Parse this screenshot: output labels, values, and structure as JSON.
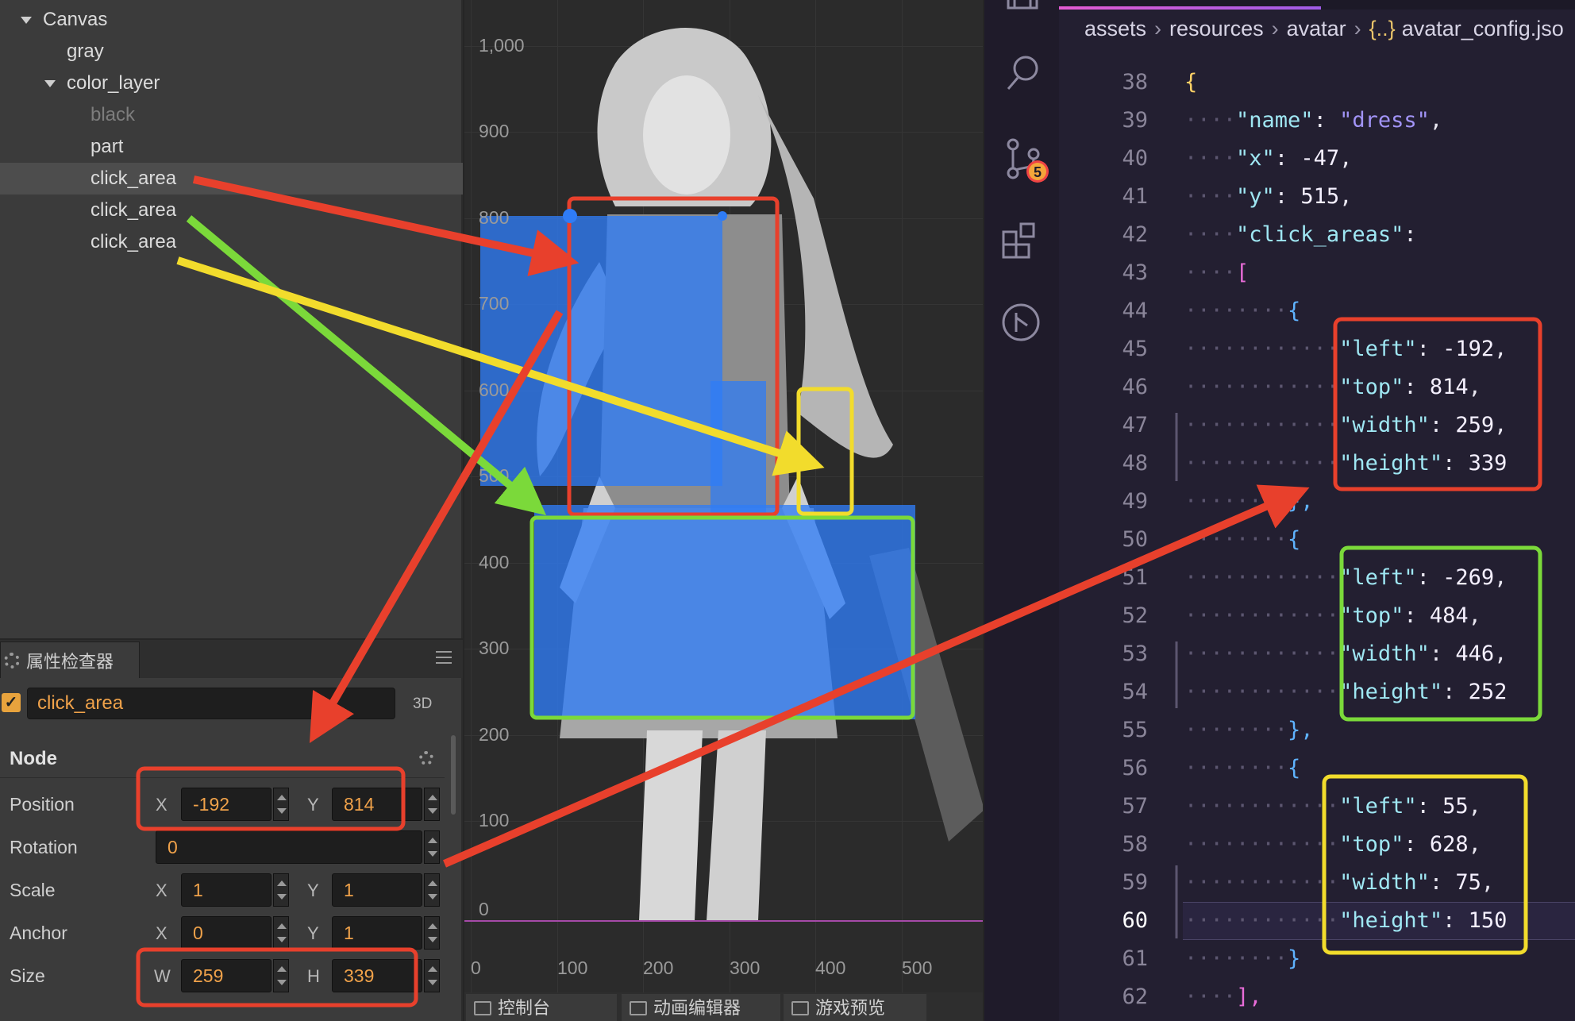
{
  "hierarchy": {
    "items": [
      {
        "label": "Canvas",
        "expanded": true,
        "depth": 0
      },
      {
        "label": "gray",
        "depth": 1
      },
      {
        "label": "color_layer",
        "expanded": true,
        "depth": 1
      },
      {
        "label": "black",
        "depth": 2,
        "dim": true
      },
      {
        "label": "part",
        "depth": 2
      },
      {
        "label": "click_area",
        "depth": 2,
        "selected": true
      },
      {
        "label": "click_area",
        "depth": 2
      },
      {
        "label": "click_area",
        "depth": 2
      }
    ]
  },
  "inspector": {
    "tab_label": "属性检查器",
    "node_name": "click_area",
    "mode_3d": "3D",
    "section_title": "Node",
    "position": {
      "label": "Position",
      "x_axis": "X",
      "y_axis": "Y",
      "x": "-192",
      "y": "814"
    },
    "rotation": {
      "label": "Rotation",
      "value": "0"
    },
    "scale": {
      "label": "Scale",
      "x_axis": "X",
      "y_axis": "Y",
      "x": "1",
      "y": "1"
    },
    "anchor": {
      "label": "Anchor",
      "x_axis": "X",
      "y_axis": "Y",
      "x": "0",
      "y": "1"
    },
    "size": {
      "label": "Size",
      "w_axis": "W",
      "h_axis": "H",
      "w": "259",
      "h": "339"
    }
  },
  "scene": {
    "y_ticks": [
      "1,000",
      "900",
      "800",
      "700",
      "600",
      "500",
      "400",
      "300",
      "200",
      "100",
      "0"
    ],
    "x_ticks": [
      "0",
      "100",
      "200",
      "300",
      "400",
      "500"
    ],
    "click_areas_colors": {
      "dress_top": "#e8402c",
      "skirt": "#7bd93a",
      "sleeve": "#f2dc2c"
    },
    "fill_color": "#2f7cf6"
  },
  "bottom_tabs": [
    "控制台",
    "动画编辑器",
    "游戏预览"
  ],
  "activity_bar": {
    "badge": "5",
    "icons": [
      "explorer-icon",
      "search-icon",
      "source-control-icon",
      "extensions-icon",
      "git-graph-icon"
    ]
  },
  "editor": {
    "breadcrumb": [
      "assets",
      "resources",
      "avatar",
      "avatar_config.jso"
    ],
    "active_line": "60",
    "lines": [
      {
        "n": "38",
        "text": "{",
        "cls": "b1",
        "indent": 0
      },
      {
        "n": "39",
        "key": "\"name\"",
        "val": "\"dress\"",
        "vcls": "s",
        "tail": ",",
        "indent": 1
      },
      {
        "n": "40",
        "key": "\"x\"",
        "val": "-47",
        "vcls": "n",
        "tail": ",",
        "indent": 1
      },
      {
        "n": "41",
        "key": "\"y\"",
        "val": "515",
        "vcls": "n",
        "tail": ",",
        "indent": 1
      },
      {
        "n": "42",
        "key": "\"click_areas\"",
        "val": "",
        "vcls": "n",
        "tail": "",
        "indent": 1
      },
      {
        "n": "43",
        "text": "[",
        "cls": "b2",
        "indent": 1
      },
      {
        "n": "44",
        "text": "{",
        "cls": "b3",
        "indent": 2
      },
      {
        "n": "45",
        "key": "\"left\"",
        "val": "-192",
        "vcls": "n",
        "tail": ",",
        "indent": 3
      },
      {
        "n": "46",
        "key": "\"top\"",
        "val": "814",
        "vcls": "n",
        "tail": ",",
        "indent": 3
      },
      {
        "n": "47",
        "key": "\"width\"",
        "val": "259",
        "vcls": "n",
        "tail": ",",
        "indent": 3
      },
      {
        "n": "48",
        "key": "\"height\"",
        "val": "339",
        "vcls": "n",
        "tail": "",
        "indent": 3
      },
      {
        "n": "49",
        "text": "},",
        "cls": "b3",
        "indent": 2
      },
      {
        "n": "50",
        "text": "{",
        "cls": "b3",
        "indent": 2
      },
      {
        "n": "51",
        "key": "\"left\"",
        "val": "-269",
        "vcls": "n",
        "tail": ",",
        "indent": 3
      },
      {
        "n": "52",
        "key": "\"top\"",
        "val": "484",
        "vcls": "n",
        "tail": ",",
        "indent": 3
      },
      {
        "n": "53",
        "key": "\"width\"",
        "val": "446",
        "vcls": "n",
        "tail": ",",
        "indent": 3
      },
      {
        "n": "54",
        "key": "\"height\"",
        "val": "252",
        "vcls": "n",
        "tail": "",
        "indent": 3
      },
      {
        "n": "55",
        "text": "},",
        "cls": "b3",
        "indent": 2
      },
      {
        "n": "56",
        "text": "{",
        "cls": "b3",
        "indent": 2
      },
      {
        "n": "57",
        "key": "\"left\"",
        "val": "55",
        "vcls": "n",
        "tail": ",",
        "indent": 3
      },
      {
        "n": "58",
        "key": "\"top\"",
        "val": "628",
        "vcls": "n",
        "tail": ",",
        "indent": 3
      },
      {
        "n": "59",
        "key": "\"width\"",
        "val": "75",
        "vcls": "n",
        "tail": ",",
        "indent": 3
      },
      {
        "n": "60",
        "key": "\"height\"",
        "val": "150",
        "vcls": "n",
        "tail": "",
        "indent": 3
      },
      {
        "n": "61",
        "text": "}",
        "cls": "b3",
        "indent": 2
      },
      {
        "n": "62",
        "text": "],",
        "cls": "b2",
        "indent": 1
      }
    ]
  }
}
